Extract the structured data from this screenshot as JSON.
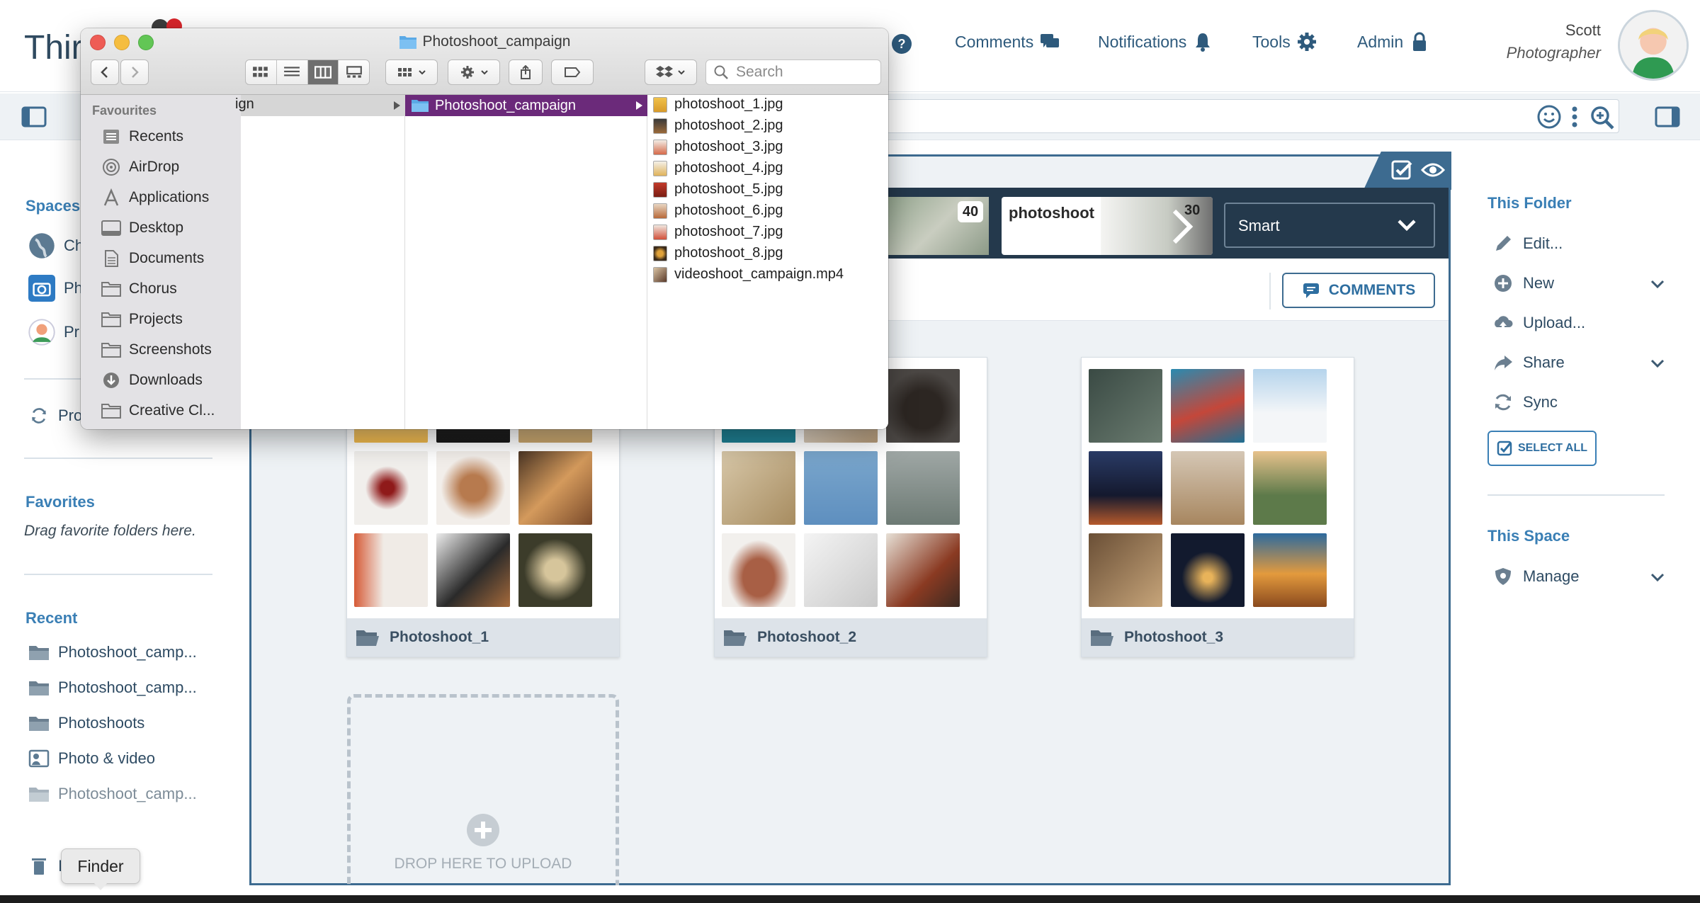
{
  "app": {
    "brand": "Thir"
  },
  "header": {
    "nav": [
      {
        "label": "Comments",
        "icon": "comments-icon"
      },
      {
        "label": "Notifications",
        "icon": "bell-icon"
      },
      {
        "label": "Tools",
        "icon": "gear-icon"
      },
      {
        "label": "Admin",
        "icon": "lock-icon"
      }
    ],
    "help_icon": "help-icon",
    "user": {
      "name": "Scott",
      "role": "Photographer"
    }
  },
  "left_sidebar": {
    "spaces_title": "Spaces",
    "spaces": [
      {
        "label": "Ch"
      },
      {
        "label": "Ph"
      },
      {
        "label": "Pr"
      }
    ],
    "sync_label": "Pro",
    "favorites_title": "Favorites",
    "favorites_hint": "Drag favorite folders here.",
    "recent_title": "Recent",
    "recent": [
      {
        "label": "Photoshoot_camp..."
      },
      {
        "label": "Photoshoot_camp..."
      },
      {
        "label": "Photoshoots"
      },
      {
        "label": "Photo & video"
      },
      {
        "label": "Photoshoot_camp..."
      }
    ],
    "trash_label": "I"
  },
  "smartbar": {
    "cards": [
      {
        "count": "40"
      },
      {
        "label": "photoshoot",
        "count": "30"
      }
    ],
    "smart_select": "Smart"
  },
  "main": {
    "comments_button": "COMMENTS",
    "folders": [
      {
        "name": "Photoshoot_1"
      },
      {
        "name": "Photoshoot_2"
      },
      {
        "name": "Photoshoot_3"
      }
    ],
    "dropzone_label": "DROP HERE TO UPLOAD"
  },
  "right_sidebar": {
    "this_folder_title": "This Folder",
    "actions": [
      {
        "label": "Edit...",
        "icon": "pencil-icon"
      },
      {
        "label": "New",
        "icon": "plus-icon"
      },
      {
        "label": "Upload...",
        "icon": "upload-icon"
      },
      {
        "label": "Share",
        "icon": "share-icon"
      },
      {
        "label": "Sync",
        "icon": "sync-icon"
      }
    ],
    "select_all": "SELECT ALL",
    "this_space_title": "This Space",
    "manage": "Manage"
  },
  "finder": {
    "title": "Photoshoot_campaign",
    "search_placeholder": "Search",
    "favourites_title": "Favourites",
    "favourites": [
      {
        "label": "Recents"
      },
      {
        "label": "AirDrop"
      },
      {
        "label": "Applications"
      },
      {
        "label": "Desktop"
      },
      {
        "label": "Documents"
      },
      {
        "label": "Chorus"
      },
      {
        "label": "Projects"
      },
      {
        "label": "Screenshots"
      },
      {
        "label": "Downloads"
      },
      {
        "label": "Creative Cl..."
      }
    ],
    "col1_item": "ign",
    "col2_item": "Photoshoot_campaign",
    "files": [
      {
        "name": "photoshoot_1.jpg"
      },
      {
        "name": "photoshoot_2.jpg"
      },
      {
        "name": "photoshoot_3.jpg"
      },
      {
        "name": "photoshoot_4.jpg"
      },
      {
        "name": "photoshoot_5.jpg"
      },
      {
        "name": "photoshoot_6.jpg"
      },
      {
        "name": "photoshoot_7.jpg"
      },
      {
        "name": "photoshoot_8.jpg"
      },
      {
        "name": "videoshoot_campaign.mp4"
      }
    ]
  },
  "dock_tooltip": "Finder",
  "colors": {
    "accent": "#3a7fb5",
    "dark_bar": "#24394c",
    "finder_selection": "#6b2a7a"
  }
}
